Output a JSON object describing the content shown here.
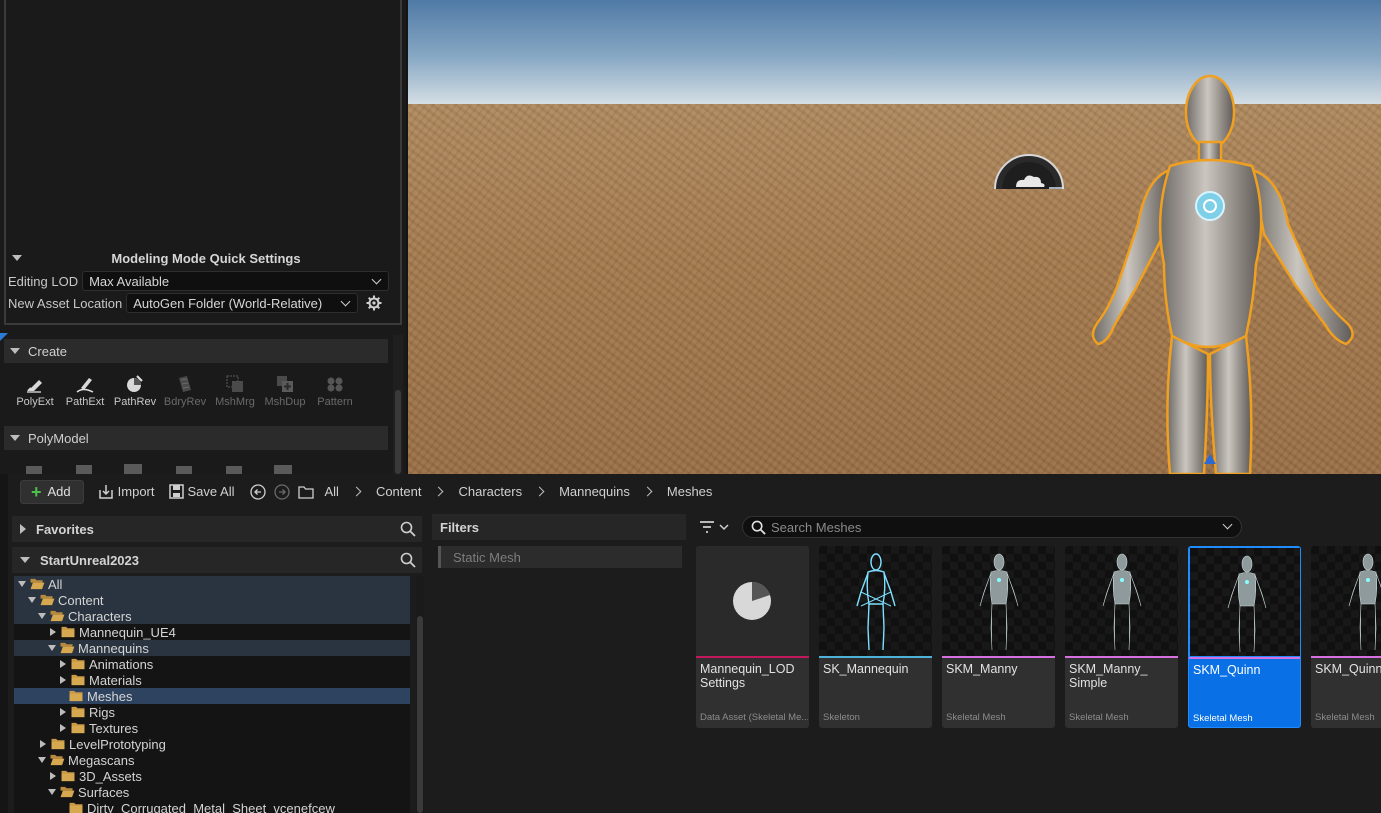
{
  "quick_settings": {
    "title": "Modeling Mode Quick Settings",
    "editing_lod_label": "Editing LOD",
    "editing_lod_value": "Max Available",
    "new_asset_location_label": "New Asset Location",
    "new_asset_location_value": "AutoGen Folder (World-Relative)"
  },
  "create_section": {
    "title": "Create",
    "tools": [
      "PolyExt",
      "PathExt",
      "PathRev",
      "BdryRev",
      "MshMrg",
      "MshDup",
      "Pattern"
    ]
  },
  "polymodel_section": {
    "title": "PolyModel"
  },
  "toolbar": {
    "add_label": "Add",
    "import_label": "Import",
    "save_all_label": "Save All",
    "breadcrumb": [
      "All",
      "Content",
      "Characters",
      "Mannequins",
      "Meshes"
    ]
  },
  "sources": {
    "favorites_label": "Favorites",
    "project_label": "StartUnreal2023",
    "tree": [
      {
        "label": "All",
        "depth": 0,
        "expanded": true,
        "state": "hl"
      },
      {
        "label": "Content",
        "depth": 1,
        "expanded": true,
        "state": "hl"
      },
      {
        "label": "Characters",
        "depth": 2,
        "expanded": true,
        "state": "hl"
      },
      {
        "label": "Mannequin_UE4",
        "depth": 3,
        "expanded": false,
        "state": ""
      },
      {
        "label": "Mannequins",
        "depth": 3,
        "expanded": true,
        "state": "hl"
      },
      {
        "label": "Animations",
        "depth": 4,
        "expanded": false,
        "state": ""
      },
      {
        "label": "Materials",
        "depth": 4,
        "expanded": false,
        "state": ""
      },
      {
        "label": "Meshes",
        "depth": 4,
        "expanded": null,
        "state": "sel"
      },
      {
        "label": "Rigs",
        "depth": 4,
        "expanded": false,
        "state": ""
      },
      {
        "label": "Textures",
        "depth": 4,
        "expanded": false,
        "state": ""
      },
      {
        "label": "LevelPrototyping",
        "depth": 2,
        "expanded": false,
        "state": ""
      },
      {
        "label": "Megascans",
        "depth": 2,
        "expanded": true,
        "state": ""
      },
      {
        "label": "3D_Assets",
        "depth": 3,
        "expanded": false,
        "state": ""
      },
      {
        "label": "Surfaces",
        "depth": 3,
        "expanded": true,
        "state": ""
      },
      {
        "label": "Dirty_Corrugated_Metal_Sheet_vcenefcew",
        "depth": 4,
        "expanded": null,
        "state": ""
      }
    ]
  },
  "filters": {
    "title": "Filters",
    "items": [
      "Static Mesh"
    ]
  },
  "assets": {
    "search_placeholder": "Search Meshes",
    "items": [
      {
        "name": "Mannequin_LOD Settings",
        "type": "Data Asset (Skeletal Me...",
        "stripe": "#c2185b",
        "kind": "data"
      },
      {
        "name": "SK_Mannequin",
        "type": "Skeleton",
        "stripe": "#4fb3d9",
        "kind": "skeleton"
      },
      {
        "name": "SKM_Manny",
        "type": "Skeletal Mesh",
        "stripe": "#d66fe0",
        "kind": "mesh"
      },
      {
        "name": "SKM_Manny_ Simple",
        "type": "Skeletal Mesh",
        "stripe": "#d66fe0",
        "kind": "mesh"
      },
      {
        "name": "SKM_Quinn",
        "type": "Skeletal Mesh",
        "stripe": "#d66fe0",
        "kind": "mesh",
        "selected": true
      },
      {
        "name": "SKM_Quinn_S",
        "type": "Skeletal Mesh",
        "stripe": "#d66fe0",
        "kind": "mesh"
      }
    ]
  },
  "colors": {
    "selection": "#0a70e6",
    "add_plus": "#4cc24c",
    "selected_outline": "#f0a020"
  }
}
